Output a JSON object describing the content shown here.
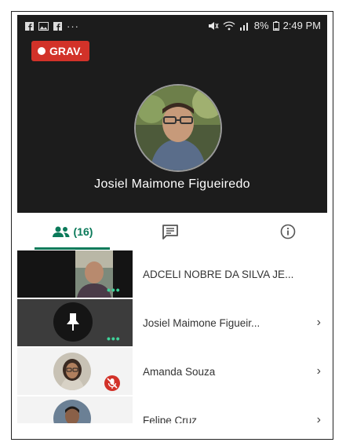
{
  "status_bar": {
    "left_dots": "···",
    "battery": "8%",
    "time": "2:49 PM"
  },
  "recording": {
    "label": "GRAV."
  },
  "main_speaker": {
    "name": "Josiel Maimone Figueiredo"
  },
  "tabs": [
    {
      "label": "(16)",
      "icon": "people-icon",
      "active": true
    },
    {
      "label": "",
      "icon": "chat-icon",
      "active": false
    },
    {
      "label": "",
      "icon": "info-icon",
      "active": false
    }
  ],
  "participants": [
    {
      "name": "ADCELI NOBRE DA SILVA JE...",
      "chevron": ""
    },
    {
      "name": "Josiel Maimone Figueir...",
      "chevron": "›"
    },
    {
      "name": "Amanda Souza",
      "chevron": "›"
    },
    {
      "name": "Felipe Cruz",
      "chevron": "›"
    }
  ],
  "colors": {
    "accent": "#0b7a5a",
    "record": "#d23229",
    "more_dots": "#3fd39a",
    "muted": "#d23229"
  }
}
